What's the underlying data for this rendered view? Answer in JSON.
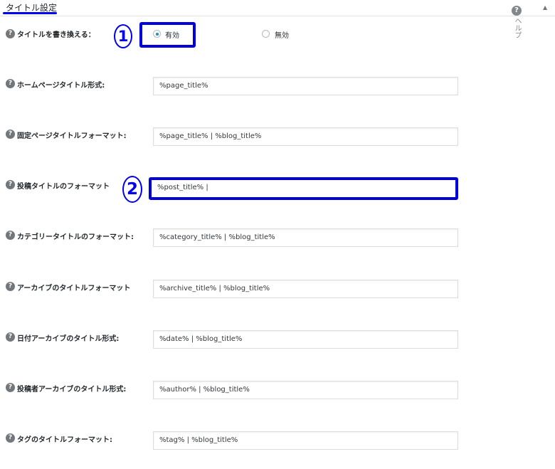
{
  "header": {
    "section_title": "タイトル設定",
    "collapse_arrow": "▲",
    "help_icon": "?",
    "help_tab_label": "ヘルプ"
  },
  "rewrite_titles": {
    "label": "タイトルを書き換える：",
    "options": [
      {
        "label": "有効",
        "selected": true
      },
      {
        "label": "無効",
        "selected": false
      }
    ]
  },
  "fields": [
    {
      "label": "ホームページタイトル形式:",
      "value": "%page_title%"
    },
    {
      "label": "固定ページタイトルフォーマット:",
      "value": "%page_title% | %blog_title%"
    },
    {
      "label": "投稿タイトルのフォーマット",
      "value": "%post_title% |"
    },
    {
      "label": "カテゴリータイトルのフォーマット:",
      "value": "%category_title% | %blog_title%"
    },
    {
      "label": "アーカイブのタイトルフォーマット",
      "value": "%archive_title% | %blog_title%"
    },
    {
      "label": "日付アーカイブのタイトル形式:",
      "value": "%date% | %blog_title%"
    },
    {
      "label": "投稿者アーカイブのタイトル形式:",
      "value": "%author% | %blog_title%"
    },
    {
      "label": "タグのタイトルフォーマット:",
      "value": "%tag% | %blog_title%"
    }
  ],
  "annotations": {
    "callout_1": "1",
    "callout_2": "2",
    "highlight_color": "#0000dd"
  },
  "icons": {
    "row_help_icon": "?"
  }
}
